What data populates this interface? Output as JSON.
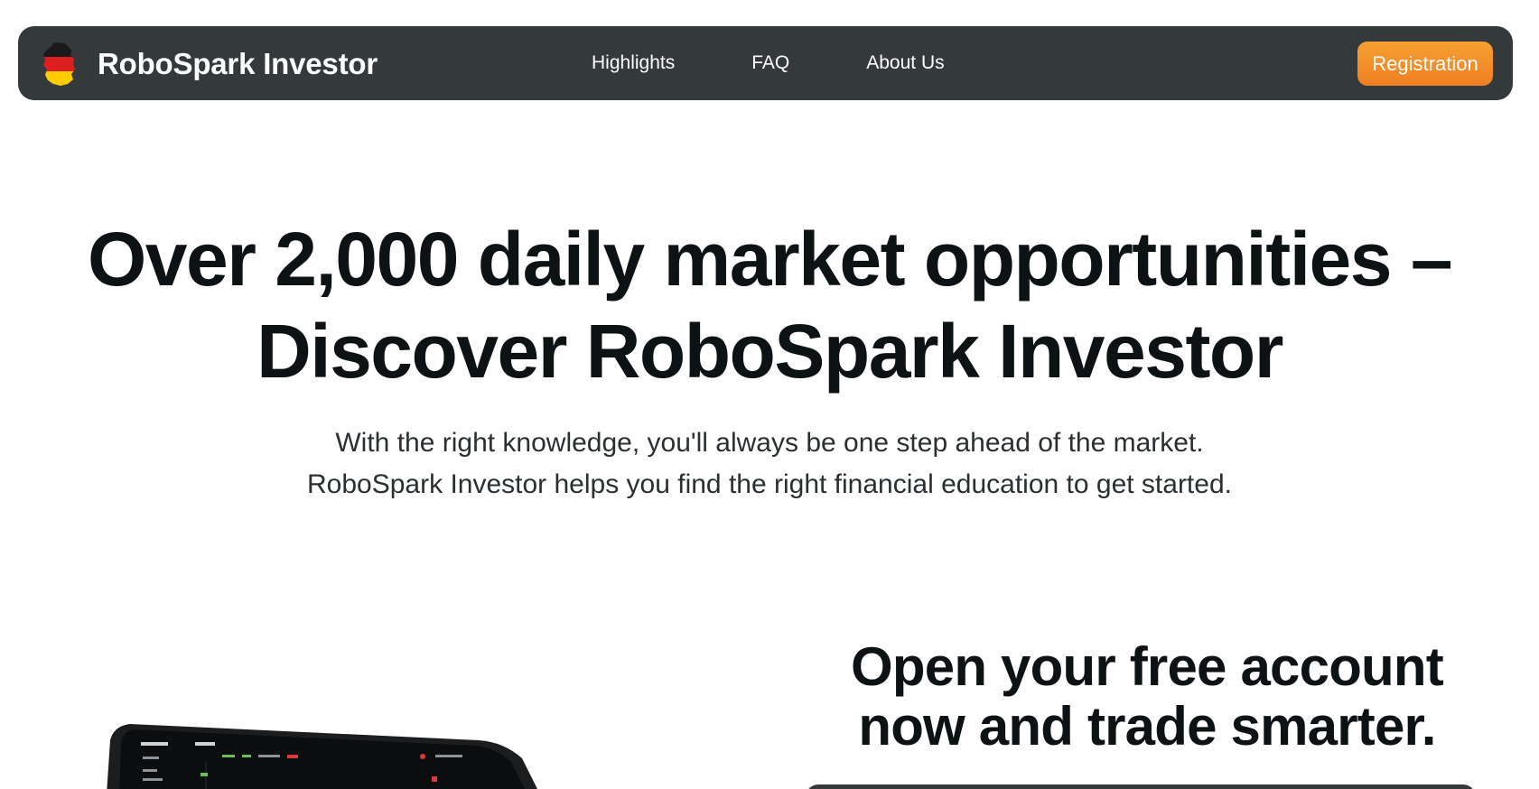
{
  "header": {
    "brand_name": "RoboSpark Investor",
    "logo_icon": "germany-flag-map-icon",
    "nav": [
      {
        "label": "Highlights"
      },
      {
        "label": "FAQ"
      },
      {
        "label": "About Us"
      }
    ],
    "cta_label": "Registration"
  },
  "hero": {
    "title": "Over 2,000 daily market opportunities – Discover RoboSpark Investor",
    "subtitle_line1": "With the right knowledge, you'll always be one step ahead of the market.",
    "subtitle_line2": "RoboSpark Investor helps you find the right financial education to get started."
  },
  "signup": {
    "title_line1": "Open your free account",
    "title_line2": "now and trade smarter."
  },
  "colors": {
    "navbar_bg": "#343a3c",
    "cta_gradient_top": "#f7a032",
    "cta_gradient_bottom": "#ef7f22",
    "heading_text": "#0d1214",
    "body_text": "#2a2f31"
  }
}
